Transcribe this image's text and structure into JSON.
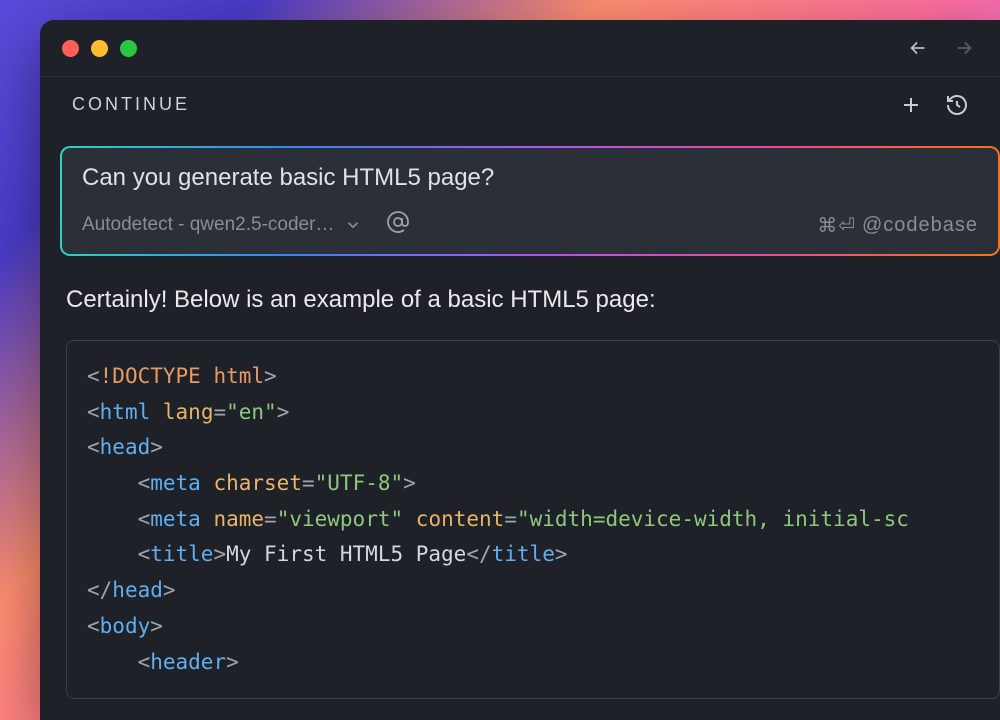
{
  "panel": {
    "tab_label": "CONTINUE"
  },
  "input": {
    "prompt": "Can you generate basic HTML5 page?",
    "model_label": "Autodetect - qwen2.5-coder…",
    "shortcut_hint": "⌘⏎",
    "context_hint": "@codebase"
  },
  "response": {
    "intro": "Certainly! Below is an example of a basic HTML5 page:",
    "code": "<!DOCTYPE html>\n<html lang=\"en\">\n<head>\n    <meta charset=\"UTF-8\">\n    <meta name=\"viewport\" content=\"width=device-width, initial-sc\n    <title>My First HTML5 Page</title>\n</head>\n<body>\n    <header>"
  },
  "icons": {
    "back": "arrow-left",
    "forward": "arrow-right",
    "new": "plus",
    "history": "history"
  }
}
